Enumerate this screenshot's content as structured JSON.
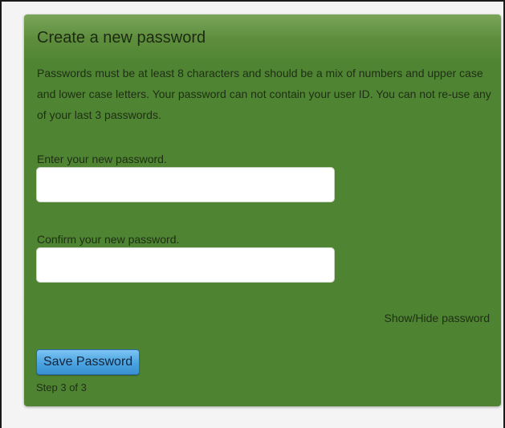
{
  "form": {
    "title": "Create a new password",
    "description": "Passwords must be at least 8 characters and should be a mix of numbers and upper case and lower case letters. Your password can not contain your user ID. You can not re-use any of your last 3 passwords.",
    "new_password": {
      "label": "Enter your new password.",
      "value": "",
      "placeholder": ""
    },
    "confirm_password": {
      "label": "Confirm your new password.",
      "value": "",
      "placeholder": ""
    },
    "toggle_label": "Show/Hide password",
    "save_label": "Save Password",
    "step_text": "Step 3 of 3"
  },
  "colors": {
    "panel": "#4f8532",
    "button": "#4aa3e0"
  }
}
